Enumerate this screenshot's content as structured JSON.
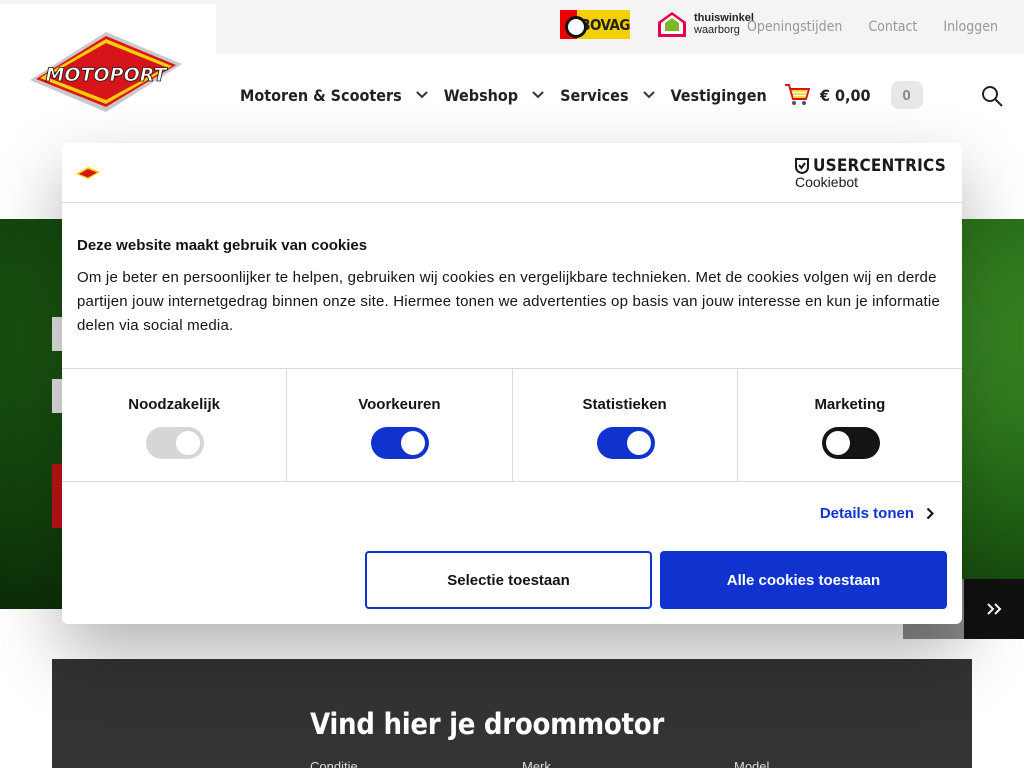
{
  "topbar": {
    "bovag_label": "BOVAG",
    "thuiswinkel_line1": "thuiswinkel",
    "thuiswinkel_line2": "waarborg",
    "links": [
      "Openingstijden",
      "Contact",
      "Inloggen"
    ]
  },
  "logo": {
    "text": "MOTOPORT"
  },
  "nav": {
    "items": [
      {
        "label": "Motoren & Scooters",
        "dropdown": true
      },
      {
        "label": "Webshop",
        "dropdown": true
      },
      {
        "label": "Services",
        "dropdown": true
      },
      {
        "label": "Vestigingen",
        "dropdown": false
      }
    ],
    "cart_total": "€ 0,00",
    "cart_count": "0"
  },
  "finder": {
    "title": "Vind hier je droommotor",
    "labels": [
      "Conditie",
      "Merk",
      "Model"
    ]
  },
  "cookie_dialog": {
    "provider": "USERCENTRICS",
    "provider_sub": "Cookiebot",
    "title": "Deze website maakt gebruik van cookies",
    "text": "Om je beter en persoonlijker te helpen, gebruiken wij cookies en vergelijkbare technieken. Met de cookies volgen wij en derde partijen jouw internetgedrag binnen onze site. Hiermee tonen we advertenties op basis van jouw interesse en kun je informatie delen via social media.",
    "toggles": [
      {
        "label": "Noodzakelijk",
        "state": "on-disabled"
      },
      {
        "label": "Voorkeuren",
        "state": "on"
      },
      {
        "label": "Statistieken",
        "state": "on"
      },
      {
        "label": "Marketing",
        "state": "off"
      }
    ],
    "details_label": "Details tonen",
    "btn_selection": "Selectie toestaan",
    "btn_all": "Alle cookies toestaan"
  },
  "colors": {
    "accent_blue": "#1032cf",
    "brand_red": "#d7141a",
    "brand_yellow": "#f7d000"
  }
}
